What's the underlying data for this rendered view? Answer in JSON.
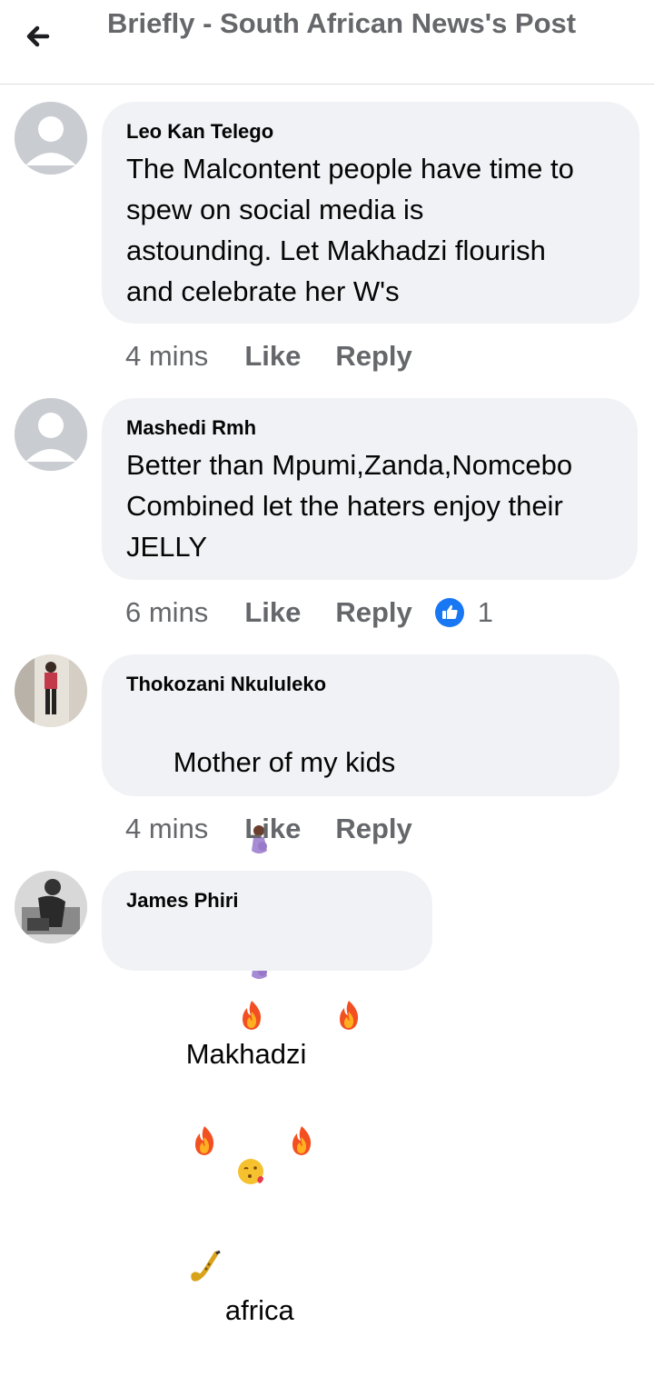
{
  "header": {
    "title": "Briefly - South African News's Post"
  },
  "comments": [
    {
      "author": "Leo Kan Telego",
      "text": "The Malcontent people have time to\nspew on social media is\nastounding. Let Makhadzi flourish\nand celebrate her W's",
      "time": "4 mins",
      "like": "Like",
      "reply": "Reply"
    },
    {
      "author": "Mashedi Rmh",
      "text": "Better than Mpumi,Zanda,Nomcebo\nCombined let the haters enjoy their\nJELLY",
      "time": "6 mins",
      "like": "Like",
      "reply": "Reply",
      "reaction_count": "1"
    },
    {
      "author": "Thokozani Nkululeko",
      "text_suffix": "Makhadzi",
      "text_prefix": "Mother of my kids",
      "time": "4 mins",
      "like": "Like",
      "reply": "Reply"
    },
    {
      "author": "James Phiri",
      "text_suffix": "africa"
    }
  ],
  "icons": {
    "back": "arrow-left-icon",
    "reaction": "like-reaction-icon",
    "emoji_pregnant": "pregnant-woman-emoji",
    "emoji_kiss": "face-blowing-kiss-emoji",
    "emoji_fire": "fire-emoji",
    "emoji_sax": "saxophone-emoji"
  },
  "colors": {
    "bubble": "#f0f2f5",
    "secondary_text": "#65676b",
    "like_blue": "#1877f2"
  }
}
